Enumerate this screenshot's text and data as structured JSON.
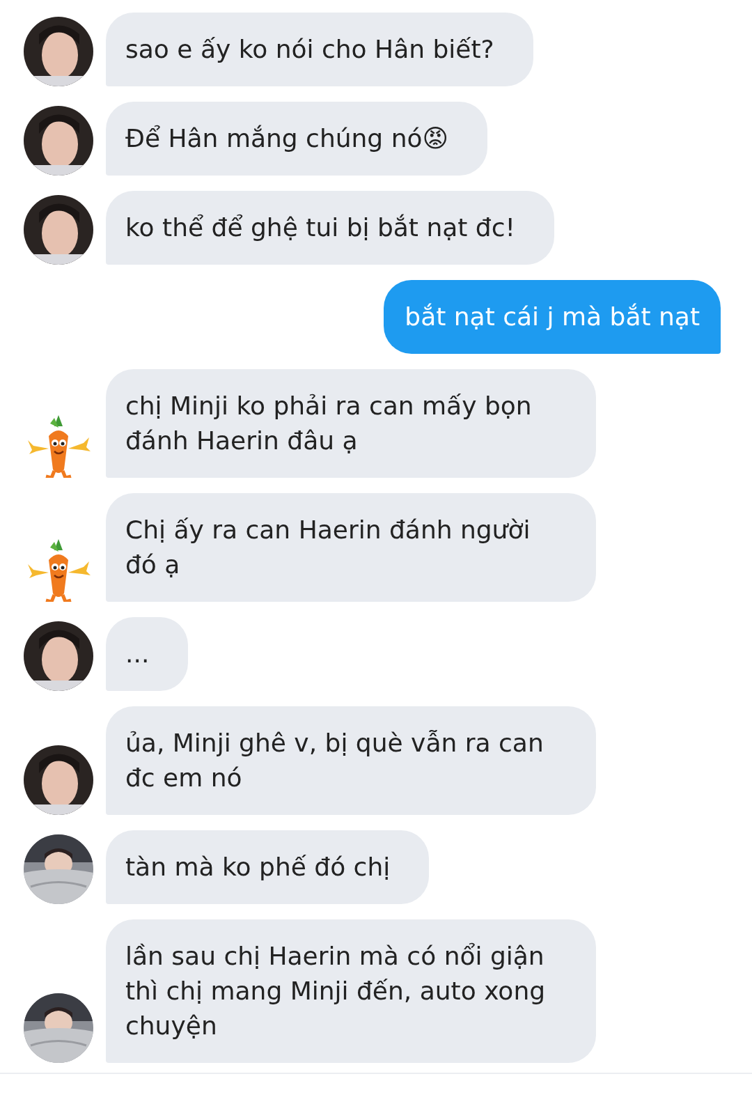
{
  "messages": [
    {
      "kind": "received",
      "avatar": {
        "kind": "portrait"
      },
      "text": "sao e ấy ko nói cho Hân biết?"
    },
    {
      "kind": "received",
      "avatar": {
        "kind": "portrait"
      },
      "text": "Để Hân mắng chúng nó😡"
    },
    {
      "kind": "received",
      "avatar": {
        "kind": "portrait"
      },
      "text": "ko thể để ghệ tui bị bắt nạt đc!"
    },
    {
      "kind": "sent",
      "text": "bắt nạt cái j mà bắt nạt"
    },
    {
      "kind": "received",
      "avatar": {
        "kind": "carrot"
      },
      "text": "chị Minji ko phải ra can mấy bọn đánh Haerin đâu ạ"
    },
    {
      "kind": "received",
      "avatar": {
        "kind": "carrot"
      },
      "text": "Chị ấy ra can Haerin đánh người đó ạ"
    },
    {
      "kind": "received",
      "avatar": {
        "kind": "portrait"
      },
      "text": "..."
    },
    {
      "kind": "received",
      "avatar": {
        "kind": "portrait"
      },
      "text": "ủa, Minji ghê v, bị què vẫn ra can đc em nó"
    },
    {
      "kind": "received",
      "avatar": {
        "kind": "blanket"
      },
      "text": "tàn mà ko phế đó chị"
    },
    {
      "kind": "received",
      "avatar": {
        "kind": "blanket"
      },
      "text": "lần sau chị Haerin mà có nổi giận thì chị mang Minji đến, auto xong chuyện"
    }
  ]
}
